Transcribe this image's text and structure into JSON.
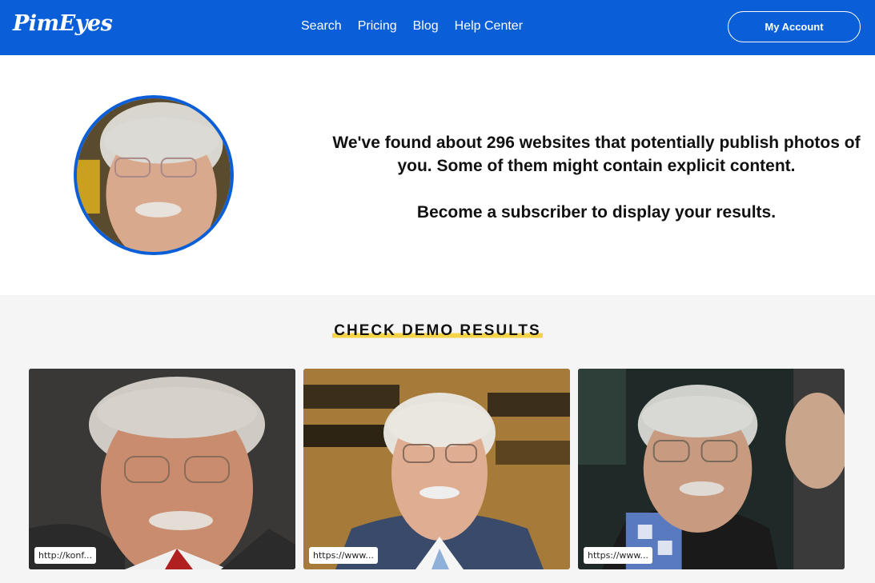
{
  "header": {
    "logo": "PimEyes",
    "nav": [
      {
        "label": "Search"
      },
      {
        "label": "Pricing"
      },
      {
        "label": "Blog"
      },
      {
        "label": "Help Center"
      }
    ],
    "account_label": "My Account",
    "brand_color": "#0a5fd8"
  },
  "result": {
    "message_line1": "We've found about 296 websites that potentially publish photos of you. Some of them might contain explicit content.",
    "message_line2": "Become a subscriber to display your results."
  },
  "demo": {
    "title": "CHECK DEMO RESULTS",
    "highlight_color": "#f5d547",
    "cards": [
      {
        "url": "http://konf..."
      },
      {
        "url": "https://www..."
      },
      {
        "url": "https://www..."
      }
    ]
  }
}
